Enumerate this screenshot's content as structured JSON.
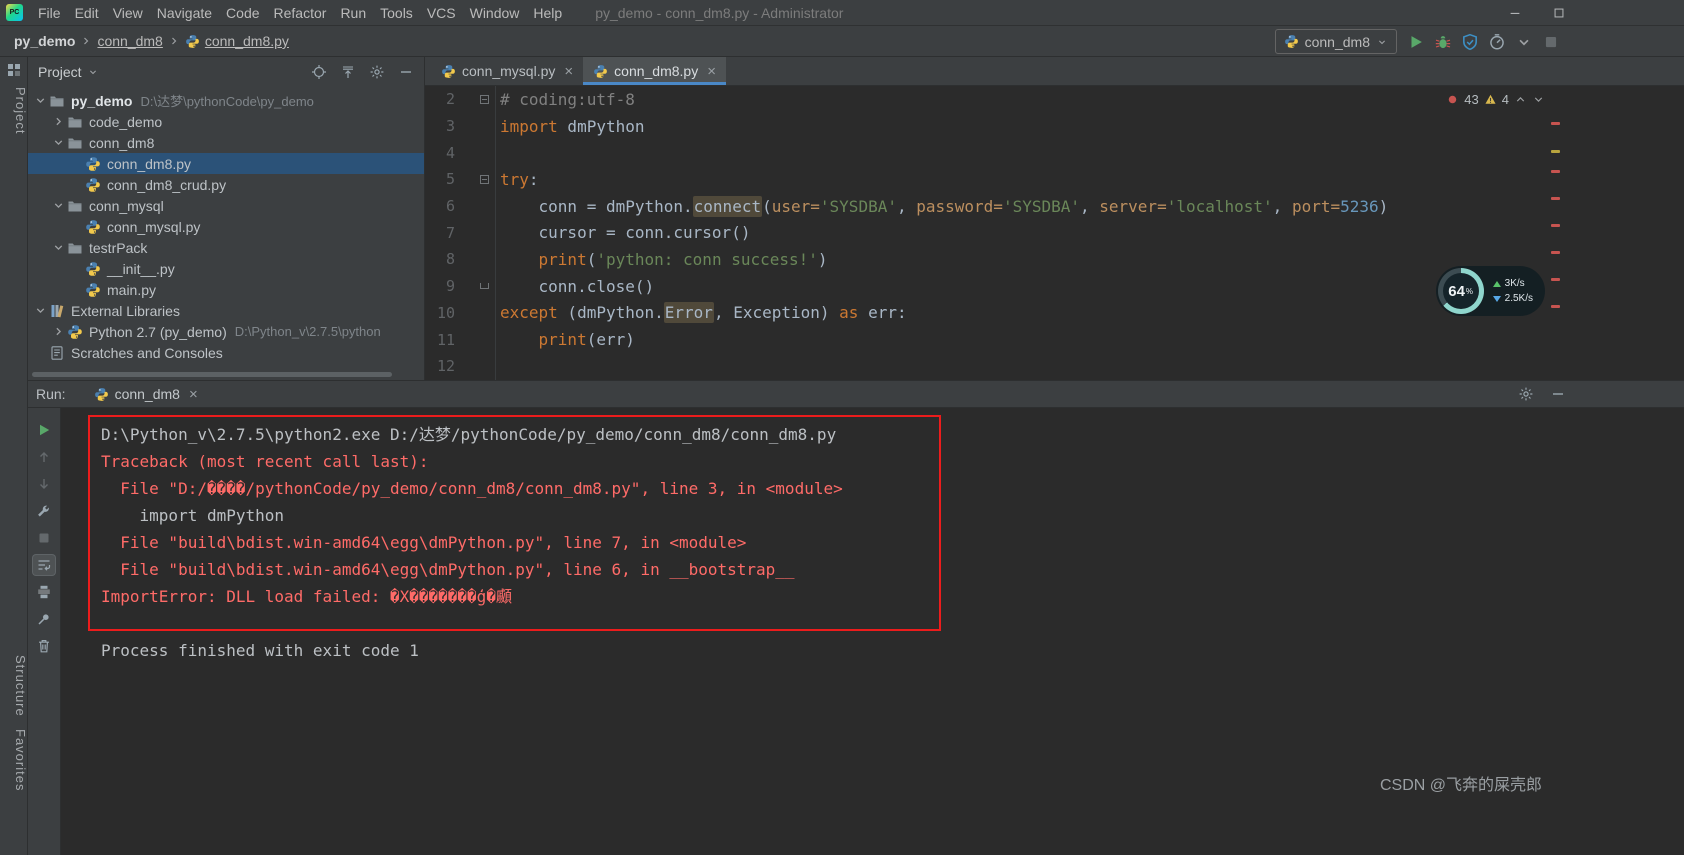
{
  "window": {
    "app_icon_text": "PC",
    "title": "py_demo - conn_dm8.py - Administrator"
  },
  "menubar": {
    "items": [
      {
        "label": "File"
      },
      {
        "label": "Edit"
      },
      {
        "label": "View"
      },
      {
        "label": "Navigate"
      },
      {
        "label": "Code"
      },
      {
        "label": "Refactor"
      },
      {
        "label": "Run"
      },
      {
        "label": "Tools"
      },
      {
        "label": "VCS"
      },
      {
        "label": "Window"
      },
      {
        "label": "Help"
      }
    ]
  },
  "breadcrumbs": {
    "items": [
      {
        "label": "py_demo",
        "bold": true
      },
      {
        "label": "conn_dm8",
        "underline": true
      },
      {
        "label": "conn_dm8.py",
        "underline": true,
        "icon": "python"
      }
    ]
  },
  "run_controls": {
    "config_name": "conn_dm8",
    "buttons": [
      {
        "icon": "run",
        "name": "run-button"
      },
      {
        "icon": "debug",
        "name": "debug-button"
      },
      {
        "icon": "coverage",
        "name": "run-with-coverage-button"
      },
      {
        "icon": "profiler",
        "name": "profiler-button"
      },
      {
        "icon": "dropdown",
        "name": "more-run-options-button"
      },
      {
        "icon": "stop-disabled",
        "name": "stop-button",
        "disabled": true
      }
    ]
  },
  "left_strip": {
    "top_label": "Project",
    "structure_label": "Structure",
    "favorites_label": "Favorites"
  },
  "project": {
    "header_title": "Project",
    "header_buttons": [
      {
        "icon": "locate",
        "name": "select-opened-file-button"
      },
      {
        "icon": "collapse-all",
        "name": "collapse-all-button"
      },
      {
        "icon": "gear",
        "name": "project-options-button"
      },
      {
        "icon": "hide",
        "name": "hide-panel-button"
      }
    ],
    "tree": [
      {
        "depth": 0,
        "chevron": "down",
        "icon": "folder",
        "label": "py_demo",
        "path": "D:\\达梦\\pythonCode\\py_demo",
        "bold": true
      },
      {
        "depth": 1,
        "chevron": "right",
        "icon": "folder",
        "label": "code_demo"
      },
      {
        "depth": 1,
        "chevron": "down",
        "icon": "folder",
        "label": "conn_dm8"
      },
      {
        "depth": 2,
        "icon": "python",
        "label": "conn_dm8.py",
        "selected": true
      },
      {
        "depth": 2,
        "icon": "python",
        "label": "conn_dm8_crud.py"
      },
      {
        "depth": 1,
        "chevron": "down",
        "icon": "folder",
        "label": "conn_mysql"
      },
      {
        "depth": 2,
        "icon": "python",
        "label": "conn_mysql.py"
      },
      {
        "depth": 1,
        "chevron": "down",
        "icon": "folder",
        "label": "testrPack"
      },
      {
        "depth": 2,
        "icon": "python",
        "label": "__init__.py"
      },
      {
        "depth": 2,
        "icon": "python",
        "label": "main.py"
      },
      {
        "depth": 0,
        "chevron": "down",
        "icon": "library",
        "label": "External Libraries"
      },
      {
        "depth": 1,
        "chevron": "right",
        "icon": "python",
        "label": "Python 2.7 (py_demo)",
        "path": "D:\\Python_v\\2.7.5\\python"
      },
      {
        "depth": 0,
        "icon": "scratches",
        "label": "Scratches and Consoles"
      }
    ]
  },
  "editor": {
    "tabs": [
      {
        "label": "conn_mysql.py",
        "icon": "python",
        "active": false
      },
      {
        "label": "conn_dm8.py",
        "icon": "python",
        "active": true
      }
    ],
    "inspections": {
      "errors": "43",
      "warnings": "4"
    },
    "lines": [
      {
        "num": "2",
        "fold": "box",
        "tokens": [
          {
            "t": "# coding:utf-8",
            "c": "cmt"
          }
        ]
      },
      {
        "num": "3",
        "tokens": [
          {
            "t": "import",
            "c": "kw"
          },
          {
            "t": " dmPython",
            "c": "def"
          }
        ]
      },
      {
        "num": "4",
        "tokens": []
      },
      {
        "num": "5",
        "fold": "box",
        "tokens": [
          {
            "t": "try",
            "c": "kw"
          },
          {
            "t": ":",
            "c": "def"
          }
        ]
      },
      {
        "num": "6",
        "tokens": [
          {
            "t": "    conn = dmPython.",
            "c": "def"
          },
          {
            "t": "connect",
            "c": "hl"
          },
          {
            "t": "(",
            "c": "def"
          },
          {
            "t": "user=",
            "c": "param"
          },
          {
            "t": "'SYSDBA'",
            "c": "str"
          },
          {
            "t": ", ",
            "c": "def"
          },
          {
            "t": "password=",
            "c": "param"
          },
          {
            "t": "'SYSDBA'",
            "c": "str"
          },
          {
            "t": ", ",
            "c": "def"
          },
          {
            "t": "server=",
            "c": "param"
          },
          {
            "t": "'localhost'",
            "c": "str"
          },
          {
            "t": ", ",
            "c": "def"
          },
          {
            "t": "port=",
            "c": "param"
          },
          {
            "t": "5236",
            "c": "num"
          },
          {
            "t": ")",
            "c": "def"
          }
        ]
      },
      {
        "num": "7",
        "tokens": [
          {
            "t": "    cursor = conn.cursor()",
            "c": "def"
          }
        ]
      },
      {
        "num": "8",
        "tokens": [
          {
            "t": "    ",
            "c": "def"
          },
          {
            "t": "print",
            "c": "kw"
          },
          {
            "t": "(",
            "c": "def"
          },
          {
            "t": "'python: conn success!'",
            "c": "str"
          },
          {
            "t": ")",
            "c": "def"
          }
        ]
      },
      {
        "num": "9",
        "fold": "end",
        "tokens": [
          {
            "t": "    conn.close()",
            "c": "def"
          }
        ]
      },
      {
        "num": "10",
        "tokens": [
          {
            "t": "except",
            "c": "kw"
          },
          {
            "t": " (dmPython.",
            "c": "def"
          },
          {
            "t": "Error",
            "c": "hl"
          },
          {
            "t": ", Exception) ",
            "c": "def"
          },
          {
            "t": "as",
            "c": "kw"
          },
          {
            "t": " err:",
            "c": "def"
          }
        ]
      },
      {
        "num": "11",
        "tokens": [
          {
            "t": "    ",
            "c": "def"
          },
          {
            "t": "print",
            "c": "kw"
          },
          {
            "t": "(err)",
            "c": "def"
          }
        ]
      },
      {
        "num": "12",
        "tokens": []
      }
    ]
  },
  "net_widget": {
    "percent": "64",
    "percent_suffix": "%",
    "up_speed": "3K/s",
    "down_speed": "2.5K/s"
  },
  "run_panel": {
    "label": "Run:",
    "tab": {
      "label": "conn_dm8",
      "icon": "python"
    },
    "toolbar": [
      {
        "icon": "run",
        "name": "rerun-button"
      },
      {
        "icon": "stack-up",
        "name": "prev-stack-trace-button",
        "disabled": true
      },
      {
        "icon": "stack-down",
        "name": "next-stack-trace-button",
        "disabled": true
      },
      {
        "icon": "wrench",
        "name": "console-settings-button"
      },
      {
        "icon": "stop-disabled",
        "name": "stop-button",
        "disabled": true
      },
      {
        "icon": "softwrap",
        "name": "soft-wrap-toggle",
        "selected": true
      },
      {
        "icon": "print",
        "name": "print-button"
      },
      {
        "icon": "pin",
        "name": "pin-tab-toggle"
      },
      {
        "icon": "trash",
        "name": "clear-console-button"
      }
    ],
    "console_lines": [
      {
        "kind": "out",
        "text": "D:\\Python_v\\2.7.5\\python2.exe D:/达梦/pythonCode/py_demo/conn_dm8/conn_dm8.py"
      },
      {
        "kind": "err",
        "text": "Traceback (most recent call last):"
      },
      {
        "kind": "err",
        "text": "  File \"D:/����/pythonCode/py_demo/conn_dm8/conn_dm8.py\", line 3, in <module>"
      },
      {
        "kind": "out",
        "text": "    import dmPython"
      },
      {
        "kind": "err",
        "text": "  File \"build\\bdist.win-amd64\\egg\\dmPython.py\", line 7, in <module>"
      },
      {
        "kind": "err",
        "text": "  File \"build\\bdist.win-amd64\\egg\\dmPython.py\", line 6, in __bootstrap__"
      },
      {
        "kind": "err",
        "text": "ImportError: DLL load failed: �X�������ģ�顣"
      },
      {
        "kind": "blank",
        "text": ""
      },
      {
        "kind": "out",
        "text": "Process finished with exit code 1"
      }
    ]
  },
  "watermark": "CSDN @飞奔的屎壳郎",
  "colors": {
    "editor_background": "#2b2b2b",
    "panel_background": "#3c3f41",
    "selection_blue": "#2b5278",
    "tab_accent_blue": "#4a88c7",
    "keyword_orange": "#cc7832",
    "string_green": "#6a8759",
    "number_blue": "#6897bb",
    "comment_gray": "#808080",
    "console_error_red": "#ff6b68",
    "annotation_box_red": "#ec1c1c",
    "run_green": "#59a869"
  }
}
